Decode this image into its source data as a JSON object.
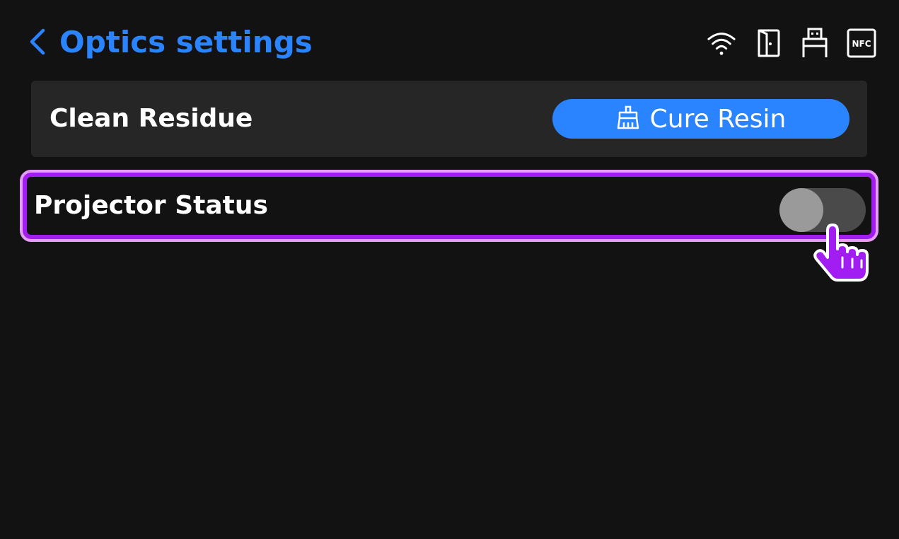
{
  "header": {
    "title": "Optics settings",
    "back_icon": "chevron-left-icon",
    "status_icons": [
      "wifi-icon",
      "door-icon",
      "usb-icon",
      "nfc-icon"
    ],
    "nfc_text": "NFC"
  },
  "rows": {
    "clean": {
      "label": "Clean Residue",
      "button_label": "Cure Resin",
      "button_icon": "broom-icon"
    },
    "projector": {
      "label": "Projector Status",
      "toggle_on": false,
      "highlighted": true
    }
  },
  "colors": {
    "accent": "#2a84ff",
    "background": "#121212",
    "row_background": "#262626",
    "highlight": "#a21df2",
    "toggle_track": "#4a4a4a",
    "toggle_knob": "#9a9a9a"
  }
}
